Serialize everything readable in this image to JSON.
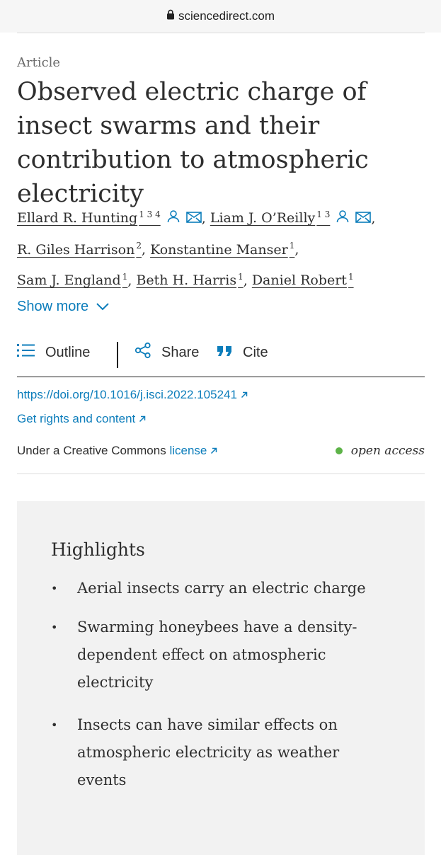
{
  "browser": {
    "url": "sciencedirect.com"
  },
  "article": {
    "type": "Article",
    "title": "Observed electric charge of insect swarms and their contribution to atmospheric electricity",
    "authors": [
      {
        "name": "Ellard R. Hunting",
        "sup": "1 3 4",
        "has_icons": true
      },
      {
        "name": "Liam J. O’Reilly",
        "sup": "1 3",
        "has_icons": true
      },
      {
        "name": "R. Giles Harrison",
        "sup": "2"
      },
      {
        "name": "Konstantine Manser",
        "sup": "1"
      },
      {
        "name": "Sam J. England",
        "sup": "1"
      },
      {
        "name": "Beth H. Harris",
        "sup": "1"
      },
      {
        "name": "Daniel Robert",
        "sup": "1"
      }
    ],
    "show_more": "Show more",
    "toolbar": {
      "outline": "Outline",
      "share": "Share",
      "cite": "Cite"
    },
    "doi": "https://doi.org/10.1016/j.isci.2022.105241",
    "rights": "Get rights and content",
    "license_prefix": "Under a Creative Commons",
    "license_link": "license",
    "open_access": "open access",
    "colors": {
      "link": "#0c7dbb",
      "open_access_dot": "#5db348",
      "highlights_bg": "#f2f2f2"
    }
  },
  "highlights": {
    "title": "Highlights",
    "items": [
      "Aerial insects carry an electric charge",
      "Swarming honeybees have a density-dependent effect on atmospheric electricity",
      "Insects can have similar effects on atmospheric electricity as weather events"
    ]
  }
}
